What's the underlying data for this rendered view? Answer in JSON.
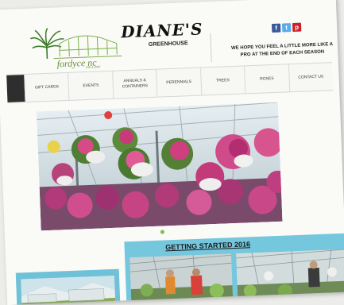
{
  "brand": {
    "title": "DIANE'S",
    "subtitle": "GREENHOUSE",
    "logo_text": "fordyce nc",
    "logo_sub": "VIA 1-DAY"
  },
  "social": {
    "facebook": "f",
    "twitter": "t",
    "pinterest": "p"
  },
  "tagline": "WE HOPE YOU FEEL A LITTLE MORE LIKE A PRO AT THE END OF EACH SEASON",
  "nav": {
    "items": [
      {
        "label": "GIFT CARDS"
      },
      {
        "label": "EVENTS"
      },
      {
        "label": "ANNUALS & CONTAINERS"
      },
      {
        "label": "PERENNIALS"
      },
      {
        "label": "TREES"
      },
      {
        "label": "ROSES"
      },
      {
        "label": "CONTACT US"
      }
    ]
  },
  "section": {
    "title": "GETTING STARTED 2016"
  },
  "colors": {
    "accent_green": "#7ac04a",
    "teal": "#74c7dc",
    "nav_dark": "#2e2e2e"
  }
}
